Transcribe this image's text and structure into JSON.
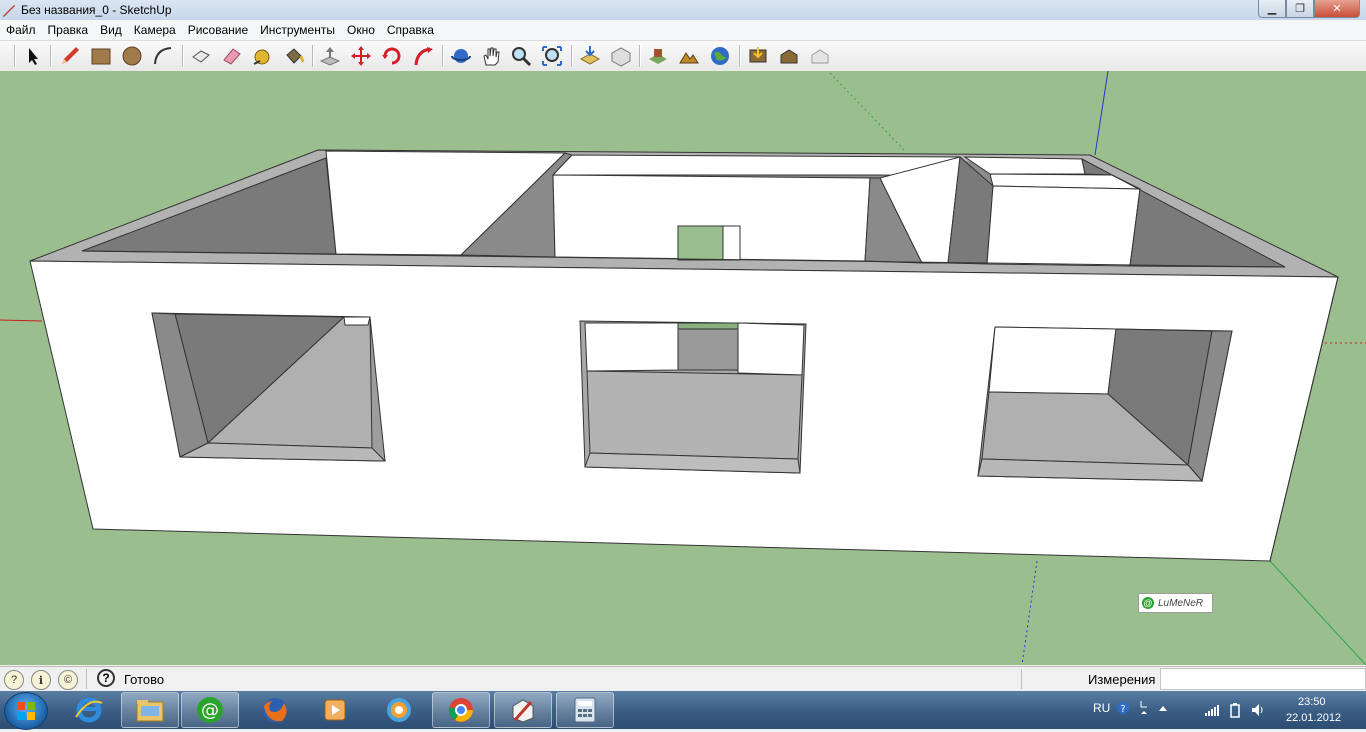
{
  "window": {
    "title": "Без названия_0 - SketchUp",
    "minimize_icon": "minimize-icon",
    "maximize_icon": "restore-icon",
    "close_label": "✕"
  },
  "menu": [
    "Файл",
    "Правка",
    "Вид",
    "Камера",
    "Рисование",
    "Инструменты",
    "Окно",
    "Справка"
  ],
  "toolbar": {
    "tools": [
      "select-icon",
      "pencil-icon",
      "rectangle-icon",
      "circle-icon",
      "arc-icon",
      "make-component-icon",
      "eraser-icon",
      "tape-measure-icon",
      "paint-bucket-icon",
      "push-pull-icon",
      "move-icon",
      "rotate-icon",
      "follow-me-icon",
      "orbit-icon",
      "pan-icon",
      "zoom-icon",
      "zoom-extents-icon",
      "get-models-icon",
      "share-model-icon",
      "add-location-icon",
      "toggle-terrain-icon",
      "google-earth-icon",
      "get-photo-texture-icon",
      "place-model-icon",
      "preview-icon"
    ]
  },
  "viewport": {
    "sky_color": "#9bbe8f",
    "watermark": "LuMeNeR"
  },
  "status": {
    "text": "Готово",
    "measurements_label": "Измерения",
    "measurements_value": ""
  },
  "taskbar": {
    "apps": [
      "ie-icon",
      "explorer-icon",
      "mail-agent-icon",
      "firefox-icon",
      "media-player-icon",
      "chromium-icon",
      "chrome-icon",
      "sketchup-icon",
      "calculator-icon"
    ],
    "lang": "RU",
    "time": "23:50",
    "date": "22.01.2012"
  }
}
